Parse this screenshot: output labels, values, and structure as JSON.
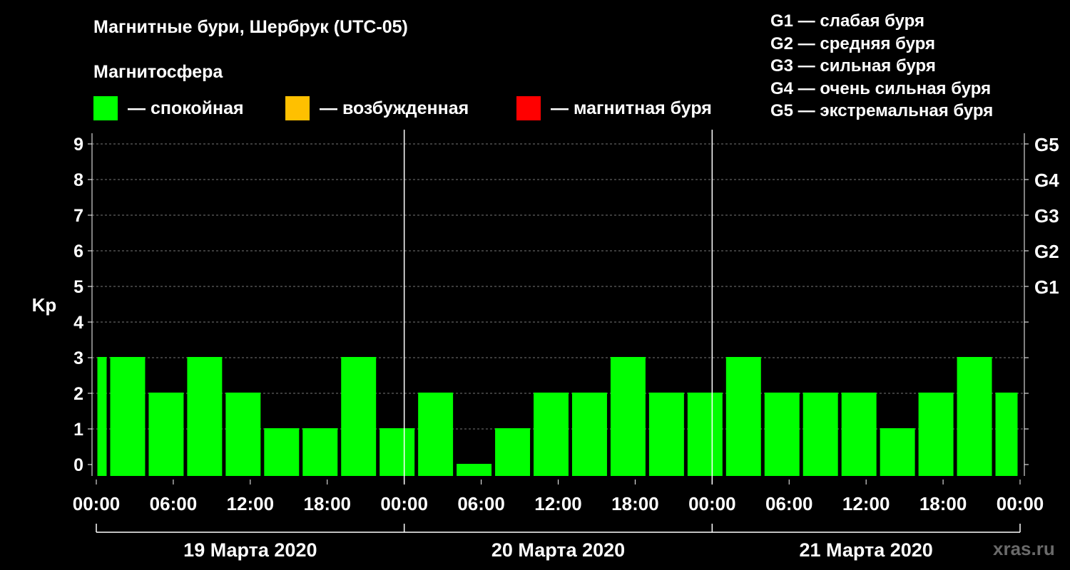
{
  "chart_data": {
    "type": "bar",
    "title": "Магнитные бури, Шербрук (UTC-05)",
    "subtitle": "Магнитосфера",
    "legend": [
      {
        "label": "— спокойная",
        "color": "#00ff00"
      },
      {
        "label": "— возбужденная",
        "color": "#ffc000"
      },
      {
        "label": "— магнитная буря",
        "color": "#ff0000"
      }
    ],
    "g_scale": [
      "G1 — слабая буря",
      "G2 — средняя буря",
      "G3 — сильная буря",
      "G4 — очень сильная буря",
      "G5 — экстремальная буря"
    ],
    "ylabel": "Kp",
    "ylim": [
      0,
      9
    ],
    "y_ticks": [
      "0",
      "1",
      "2",
      "3",
      "4",
      "5",
      "6",
      "7",
      "8",
      "9"
    ],
    "right_labels": [
      {
        "kp": 5,
        "label": "G1"
      },
      {
        "kp": 6,
        "label": "G2"
      },
      {
        "kp": 7,
        "label": "G3"
      },
      {
        "kp": 8,
        "label": "G4"
      },
      {
        "kp": 9,
        "label": "G5"
      }
    ],
    "x_tick_labels": [
      "00:00",
      "06:00",
      "12:00",
      "18:00",
      "00:00",
      "06:00",
      "12:00",
      "18:00",
      "00:00",
      "06:00",
      "12:00",
      "18:00",
      "00:00"
    ],
    "days": [
      "19 Марта 2020",
      "20 Марта 2020",
      "21 Марта 2020"
    ],
    "grid": true,
    "bars": [
      {
        "start_h": 0,
        "end_h": 1,
        "kp": 3
      },
      {
        "start_h": 1,
        "end_h": 4,
        "kp": 3
      },
      {
        "start_h": 4,
        "end_h": 7,
        "kp": 2
      },
      {
        "start_h": 7,
        "end_h": 10,
        "kp": 3
      },
      {
        "start_h": 10,
        "end_h": 13,
        "kp": 2
      },
      {
        "start_h": 13,
        "end_h": 16,
        "kp": 1
      },
      {
        "start_h": 16,
        "end_h": 19,
        "kp": 1
      },
      {
        "start_h": 19,
        "end_h": 22,
        "kp": 3
      },
      {
        "start_h": 22,
        "end_h": 25,
        "kp": 1
      },
      {
        "start_h": 25,
        "end_h": 28,
        "kp": 2
      },
      {
        "start_h": 28,
        "end_h": 31,
        "kp": 0
      },
      {
        "start_h": 31,
        "end_h": 34,
        "kp": 1
      },
      {
        "start_h": 34,
        "end_h": 37,
        "kp": 2
      },
      {
        "start_h": 37,
        "end_h": 40,
        "kp": 2
      },
      {
        "start_h": 40,
        "end_h": 43,
        "kp": 3
      },
      {
        "start_h": 43,
        "end_h": 46,
        "kp": 2
      },
      {
        "start_h": 46,
        "end_h": 49,
        "kp": 2
      },
      {
        "start_h": 49,
        "end_h": 52,
        "kp": 3
      },
      {
        "start_h": 52,
        "end_h": 55,
        "kp": 2
      },
      {
        "start_h": 55,
        "end_h": 58,
        "kp": 2
      },
      {
        "start_h": 58,
        "end_h": 61,
        "kp": 2
      },
      {
        "start_h": 61,
        "end_h": 64,
        "kp": 1
      },
      {
        "start_h": 64,
        "end_h": 67,
        "kp": 2
      },
      {
        "start_h": 67,
        "end_h": 70,
        "kp": 3
      },
      {
        "start_h": 70,
        "end_h": 72,
        "kp": 2
      }
    ],
    "bar_color": "#00ff00"
  },
  "watermark": "xras.ru"
}
